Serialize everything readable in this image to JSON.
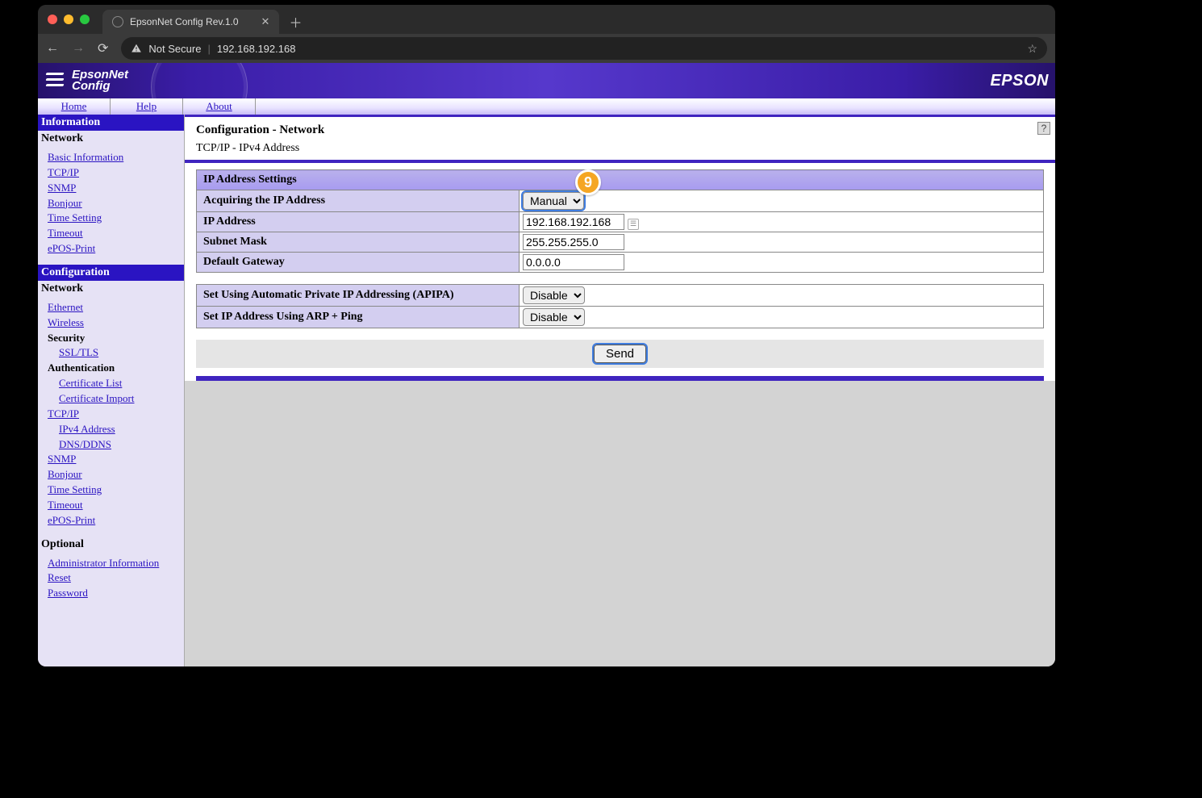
{
  "browser": {
    "tab_title": "EpsonNet Config Rev.1.0",
    "not_secure": "Not Secure",
    "url": "192.168.192.168"
  },
  "banner": {
    "logo_line1": "EpsonNet",
    "logo_line2": "Config",
    "brand": "EPSON"
  },
  "menu": {
    "home": "Home",
    "help": "Help",
    "about": "About"
  },
  "sidebar": {
    "info_header": "Information",
    "info_group": "Network",
    "info_links": [
      "Basic Information",
      "TCP/IP",
      "SNMP",
      "Bonjour",
      "Time Setting",
      "Timeout",
      "ePOS-Print"
    ],
    "cfg_header": "Configuration",
    "cfg_group": "Network",
    "cfg_net_links": [
      "Ethernet",
      "Wireless"
    ],
    "security_label": "Security",
    "security_links": [
      "SSL/TLS"
    ],
    "auth_label": "Authentication",
    "auth_links": [
      "Certificate List",
      "Certificate Import"
    ],
    "tcpip_link": "TCP/IP",
    "tcpip_sub": [
      "IPv4 Address",
      "DNS/DDNS"
    ],
    "more_links": [
      "SNMP",
      "Bonjour",
      "Time Setting",
      "Timeout",
      "ePOS-Print"
    ],
    "optional_label": "Optional",
    "optional_links": [
      "Administrator Information",
      "Reset",
      "Password"
    ]
  },
  "page": {
    "h1": "Configuration - Network",
    "h2": "TCP/IP - IPv4 Address",
    "ip_settings_header": "IP Address Settings",
    "rows": {
      "acquire_label": "Acquiring the IP Address",
      "acquire_value": "Manual",
      "ip_label": "IP Address",
      "ip_value": "192.168.192.168",
      "mask_label": "Subnet Mask",
      "mask_value": "255.255.255.0",
      "gw_label": "Default Gateway",
      "gw_value": "0.0.0.0"
    },
    "apipa_label": "Set Using Automatic Private IP Addressing (APIPA)",
    "apipa_value": "Disable",
    "arp_label": "Set IP Address Using ARP + Ping",
    "arp_value": "Disable",
    "send": "Send"
  },
  "callout": {
    "num": "9"
  }
}
